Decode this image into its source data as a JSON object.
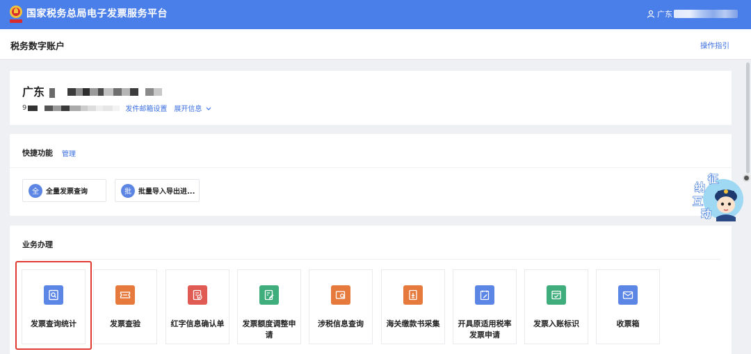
{
  "header": {
    "app_title": "国家税务总局电子发票服务平台",
    "user_prefix": "广东"
  },
  "subheader": {
    "title": "税务数字账户",
    "guide": "操作指引"
  },
  "company": {
    "name_prefix": "广东",
    "id_prefix": "9",
    "mail_settings": "发件邮箱设置",
    "expand": "展开信息"
  },
  "quick": {
    "title": "快捷功能",
    "manage": "管理",
    "items": [
      {
        "glyph": "全",
        "label": "全量发票查询"
      },
      {
        "glyph": "批",
        "label": "批量导入导出进..."
      }
    ]
  },
  "business": {
    "title": "业务办理",
    "tiles": [
      {
        "label": "发票查询统计",
        "icon": "invoice-search-icon",
        "color": "#5b86e6"
      },
      {
        "label": "发票查验",
        "icon": "ticket-verify-icon",
        "color": "#e67a3c"
      },
      {
        "label": "红字信息确认单",
        "icon": "red-confirm-icon",
        "color": "#e05b53"
      },
      {
        "label": "发票额度调整申请",
        "icon": "quota-edit-icon",
        "color": "#3fae7c"
      },
      {
        "label": "涉税信息查询",
        "icon": "tax-info-search-icon",
        "color": "#e67a3c"
      },
      {
        "label": "海关缴款书采集",
        "icon": "customs-collect-icon",
        "color": "#e67a3c"
      },
      {
        "label": "开具原适用税率发票申请",
        "icon": "rate-apply-icon",
        "color": "#5b86e6"
      },
      {
        "label": "发票入账标识",
        "icon": "account-mark-icon",
        "color": "#3fae7c"
      },
      {
        "label": "收票箱",
        "icon": "inbox-icon",
        "color": "#5b86e6"
      }
    ]
  },
  "mascot": {
    "text": "征纳互动"
  }
}
